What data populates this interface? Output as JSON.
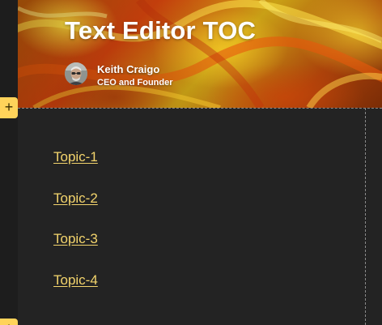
{
  "header": {
    "title": "Text Editor TOC",
    "author": {
      "name": "Keith Craigo",
      "role": "CEO and Founder"
    }
  },
  "toc": {
    "links": [
      {
        "label": "Topic-1"
      },
      {
        "label": "Topic-2"
      },
      {
        "label": "Topic-3"
      },
      {
        "label": "Topic-4"
      }
    ]
  },
  "icons": {
    "add_section_top": "plus-icon",
    "add_section_bottom": "plus-icon"
  },
  "colors": {
    "background": "#232323",
    "link": "#f3d46c",
    "add_button": "#ffd35a",
    "title": "#ffffff"
  }
}
